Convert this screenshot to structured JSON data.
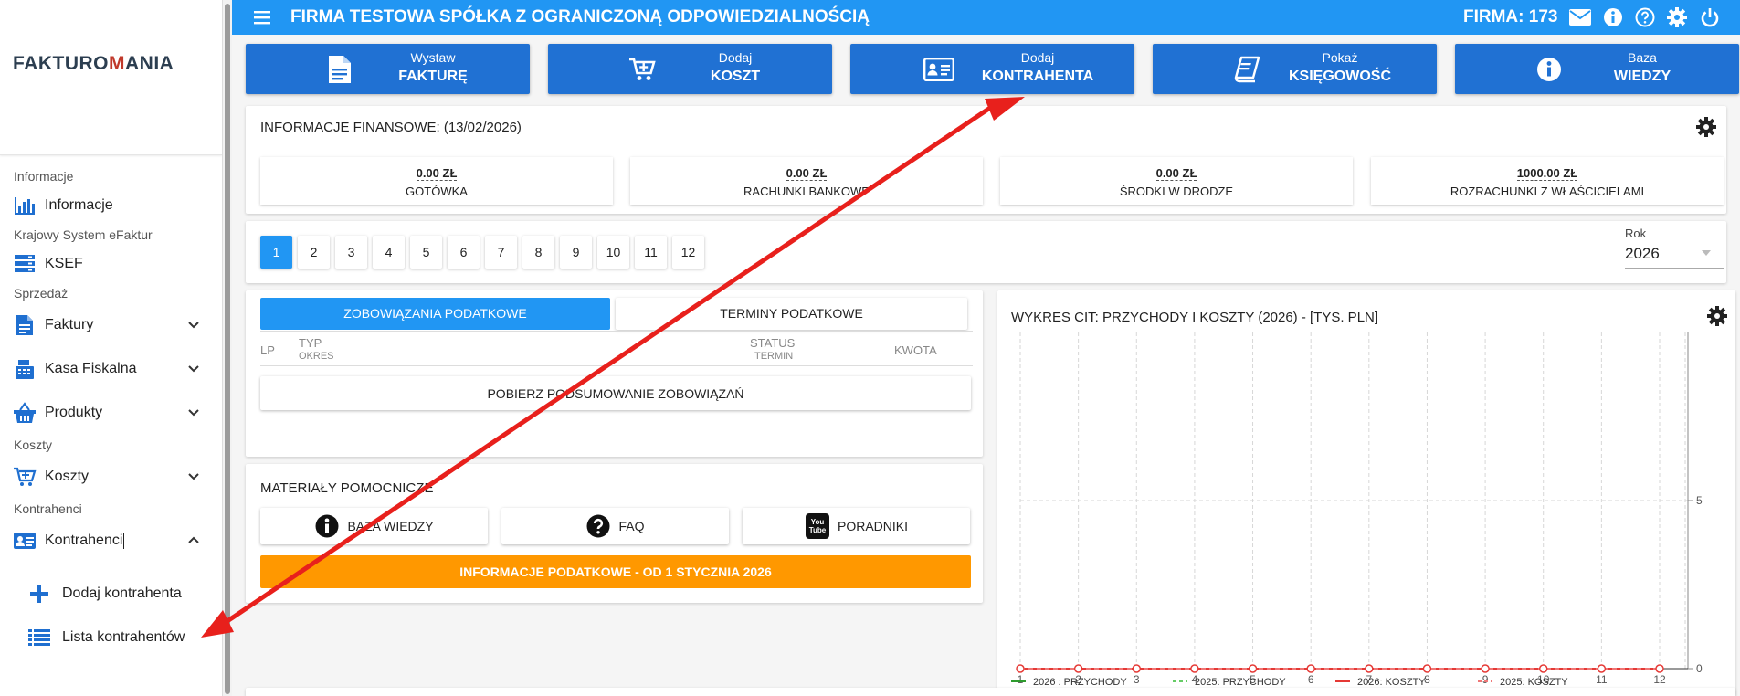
{
  "sidebar": {
    "logo_left": "FAKTURO",
    "logo_m": "M",
    "logo_right": "ANIA",
    "sections": {
      "informacje": "Informacje",
      "ksef": "Krajowy System eFaktur",
      "sprzedaz": "Sprzedaż",
      "koszty": "Koszty",
      "kontrahenci": "Kontrahenci"
    },
    "items": {
      "informacje": "Informacje",
      "ksef": "KSEF",
      "faktury": "Faktury",
      "kasa": "Kasa Fiskalna",
      "produkty": "Produkty",
      "koszty": "Koszty",
      "kontrahenci": "Kontrahenci"
    },
    "sub_items": {
      "dodaj": "Dodaj kontrahenta",
      "lista": "Lista kontrahentów"
    }
  },
  "topbar": {
    "title": "FIRMA TESTOWA SPÓŁKA Z OGRANICZONĄ ODPOWIEDZIALNOŚCIĄ",
    "firma": "FIRMA: 173"
  },
  "quick_actions": [
    {
      "line1": "Wystaw",
      "line2": "FAKTURĘ",
      "icon": "document-icon"
    },
    {
      "line1": "Dodaj",
      "line2": "KOSZT",
      "icon": "cart-plus-icon"
    },
    {
      "line1": "Dodaj",
      "line2": "KONTRAHENTA",
      "icon": "contact-card-icon"
    },
    {
      "line1": "Pokaż",
      "line2": "KSIĘGOWOŚĆ",
      "icon": "book-icon"
    },
    {
      "line1": "Baza",
      "line2": "WIEDZY",
      "icon": "info-icon"
    }
  ],
  "finance": {
    "title": "INFORMACJE FINANSOWE: (13/02/2026)",
    "cards": [
      {
        "value": "0.00 ZŁ",
        "label": "GOTÓWKA"
      },
      {
        "value": "0.00 ZŁ",
        "label": "RACHUNKI BANKOWE"
      },
      {
        "value": "0.00 ZŁ",
        "label": "ŚRODKI W DRODZE"
      },
      {
        "value": "1000.00 ZŁ",
        "label": "ROZRACHUNKI Z WŁAŚCICIELAMI"
      }
    ]
  },
  "months": {
    "items": [
      "1",
      "2",
      "3",
      "4",
      "5",
      "6",
      "7",
      "8",
      "9",
      "10",
      "11",
      "12"
    ],
    "active": "1",
    "year_label": "Rok",
    "year_value": "2026"
  },
  "tax": {
    "tab_active": "ZOBOWIĄZANIA PODATKOWE",
    "tab_inactive": "TERMINY PODATKOWE",
    "col_lp": "LP",
    "col_typ": "TYP",
    "col_okres": "OKRES",
    "col_status": "STATUS",
    "col_termin": "TERMIN",
    "col_kwota": "KWOTA",
    "button": "POBIERZ PODSUMOWANIE ZOBOWIĄZAŃ"
  },
  "materials": {
    "title": "MATERIAŁY POMOCNICZE",
    "buttons": [
      "BAZA WIEDZY",
      "FAQ",
      "PORADNIKI"
    ],
    "youtube_text": "You Tube",
    "banner": "INFORMACJE PODATKOWE - OD 1 STYCZNIA 2026"
  },
  "colors": {
    "primary": "#2196f3",
    "quick_action": "#2071d3",
    "banner": "#ff9800",
    "arrow": "#e8201c"
  },
  "chart_data": {
    "type": "line",
    "title": "WYKRES CIT: PRZYCHODY I KOSZTY (2026) - [TYS. PLN]",
    "x": [
      1,
      2,
      3,
      4,
      5,
      6,
      7,
      8,
      9,
      10,
      11,
      12
    ],
    "ylim": [
      0,
      10
    ],
    "yticks": [
      0,
      5
    ],
    "grid": true,
    "legend_position": "bottom",
    "series": [
      {
        "name": "2026 : PRZYCHODY",
        "values": [
          0,
          0,
          0,
          0,
          0,
          0,
          0,
          0,
          0,
          0,
          0,
          0
        ],
        "color": "#2e9b2e",
        "dash": false
      },
      {
        "name": "2025: PRZYCHODY",
        "values": [
          0,
          0,
          0,
          0,
          0,
          0,
          0,
          0,
          0,
          0,
          0,
          0
        ],
        "color": "#66cc66",
        "dash": true
      },
      {
        "name": "2026: KOSZTY",
        "values": [
          0,
          0,
          0,
          0,
          0,
          0,
          0,
          0,
          0,
          0,
          0,
          0
        ],
        "color": "#e53935",
        "dash": false
      },
      {
        "name": "2025: KOSZTY",
        "values": [
          0,
          0,
          0,
          0,
          0,
          0,
          0,
          0,
          0,
          0,
          0,
          0
        ],
        "color": "#ef7777",
        "dash": true
      }
    ]
  }
}
